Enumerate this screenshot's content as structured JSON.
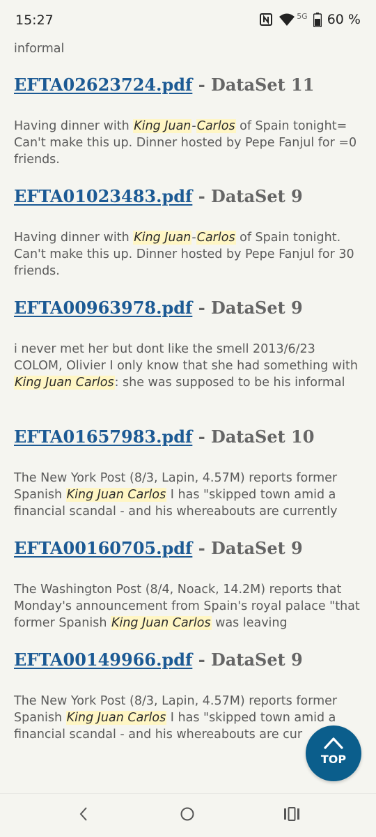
{
  "status_bar": {
    "time": "15:27",
    "network": "5G",
    "battery": "60 %",
    "icons": [
      "nfc-icon",
      "wifi-icon",
      "battery-icon"
    ]
  },
  "top_partial": {
    "text": "informal"
  },
  "results": [
    {
      "file": "EFTA02623724.pdf",
      "dataset": "- DataSet 11",
      "snippet": [
        {
          "t": "Having dinner with "
        },
        {
          "t": "King Juan",
          "hl": true
        },
        {
          "t": "-"
        },
        {
          "t": "Carlos",
          "hl": true
        },
        {
          "t": " of Spain tonight= Can't make this up. Dinner hosted by Pepe Fanjul for =0 friends."
        }
      ]
    },
    {
      "file": "EFTA01023483.pdf",
      "dataset": "- DataSet 9",
      "snippet": [
        {
          "t": "Having dinner with "
        },
        {
          "t": "King Juan",
          "hl": true
        },
        {
          "t": "-"
        },
        {
          "t": "Carlos",
          "hl": true
        },
        {
          "t": " of Spain tonight. Can't make this up. Dinner hosted by Pepe Fanjul for 30 friends."
        }
      ]
    },
    {
      "file": "EFTA00963978.pdf",
      "dataset": "- DataSet 9",
      "snippet": [
        {
          "t": "i never met her but dont like the smell 2013/6/23 COLOM, Olivier I only know that she had something with "
        },
        {
          "t": "King Juan Carlos",
          "hl": true
        },
        {
          "t": ": she was supposed to be his informal"
        }
      ]
    },
    {
      "file": "EFTA01657983.pdf",
      "dataset": "- DataSet 10",
      "snippet": [
        {
          "t": "The New York Post (8/3, Lapin, 4.57M) reports former Spanish "
        },
        {
          "t": "King Juan Carlos",
          "hl": true
        },
        {
          "t": " I has \"skipped town amid a financial scandal - and his whereabouts are currently"
        }
      ]
    },
    {
      "file": "EFTA00160705.pdf",
      "dataset": "- DataSet 9",
      "snippet": [
        {
          "t": "The Washington Post (8/4, Noack, 14.2M) reports that Monday's announcement from Spain's royal palace \"that former Spanish "
        },
        {
          "t": "King Juan Carlos",
          "hl": true
        },
        {
          "t": " was leaving"
        }
      ]
    },
    {
      "file": "EFTA00149966.pdf",
      "dataset": "- DataSet 9",
      "snippet": [
        {
          "t": "The New York Post (8/3, Lapin, 4.57M) reports former Spanish "
        },
        {
          "t": "King Juan Carlos",
          "hl": true
        },
        {
          "t": " I has \"skipped town amid a financial scandal - and his whereabouts are cur"
        }
      ]
    }
  ],
  "fab": {
    "label": "TOP",
    "icon": "chevron-up-icon"
  },
  "nav_bar": {
    "icons": [
      "back-icon",
      "home-icon",
      "recents-icon"
    ]
  },
  "colors": {
    "link": "#1c5a94",
    "highlight": "#fff6c4",
    "fab": "#0b5e8c",
    "background": "#f5f5f0"
  }
}
